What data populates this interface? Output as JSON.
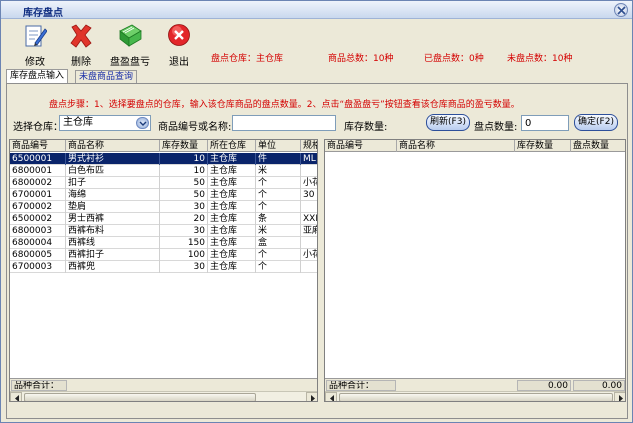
{
  "window": {
    "title": "库存盘点"
  },
  "toolbar": {
    "edit_label": "修改",
    "delete_label": "删除",
    "check_label": "盘盈盘亏",
    "exit_label": "退出"
  },
  "info": {
    "warehouse": "盘点仓库：主仓库",
    "total": "商品总数：10种",
    "counted": "已盘点数：0种",
    "uncounted": "未盘点数：10种"
  },
  "tabs": [
    {
      "label": "库存盘点输入"
    },
    {
      "label": "未盘商品查询"
    }
  ],
  "hint": "盘点步骤：1、选择要盘点的仓库，输入该仓库商品的盘点数量。2、点击“盘盈盘亏”按钮查看该仓库商品的盈亏数量。",
  "form": {
    "warehouse_label": "选择仓库：",
    "warehouse_value": "主仓库",
    "code_label": "商品编号或名称:",
    "code_value": "",
    "stock_label": "库存数量:",
    "refresh_label": "刷新(F3)",
    "count_label": "盘点数量:",
    "count_value": "0",
    "confirm_label": "确定(F2)"
  },
  "left_grid": {
    "headers": [
      "商品编号",
      "商品名称",
      "库存数量",
      "所在仓库",
      "单位",
      "规格"
    ],
    "rows": [
      [
        "6500001",
        "男式衬衫",
        "10",
        "主仓库",
        "件",
        "ML"
      ],
      [
        "6800001",
        "白色布匹",
        "10",
        "主仓库",
        "米",
        ""
      ],
      [
        "6800002",
        "扣子",
        "50",
        "主仓库",
        "个",
        "小花"
      ],
      [
        "6700001",
        "海绵",
        "50",
        "主仓库",
        "个",
        "30 X"
      ],
      [
        "6700002",
        "垫肩",
        "30",
        "主仓库",
        "个",
        ""
      ],
      [
        "6500002",
        "男士西裤",
        "20",
        "主仓库",
        "条",
        "XXL"
      ],
      [
        "6800003",
        "西裤布料",
        "30",
        "主仓库",
        "米",
        "亚麻"
      ],
      [
        "6800004",
        "西裤线",
        "150",
        "主仓库",
        "盒",
        ""
      ],
      [
        "6800005",
        "西裤扣子",
        "100",
        "主仓库",
        "个",
        "小花"
      ],
      [
        "6700003",
        "西裤兜",
        "30",
        "主仓库",
        "个",
        ""
      ]
    ],
    "footer_label": "品种合计："
  },
  "right_grid": {
    "headers": [
      "商品编号",
      "商品名称",
      "库存数量",
      "盘点数量"
    ],
    "rows": [],
    "footer_label": "品种合计：",
    "footer_stock": "0.00",
    "footer_count": "0.00"
  },
  "colors": {
    "accent": "#0a246a",
    "warning_text": "#d40000",
    "window_bg": "#ece9d8"
  }
}
